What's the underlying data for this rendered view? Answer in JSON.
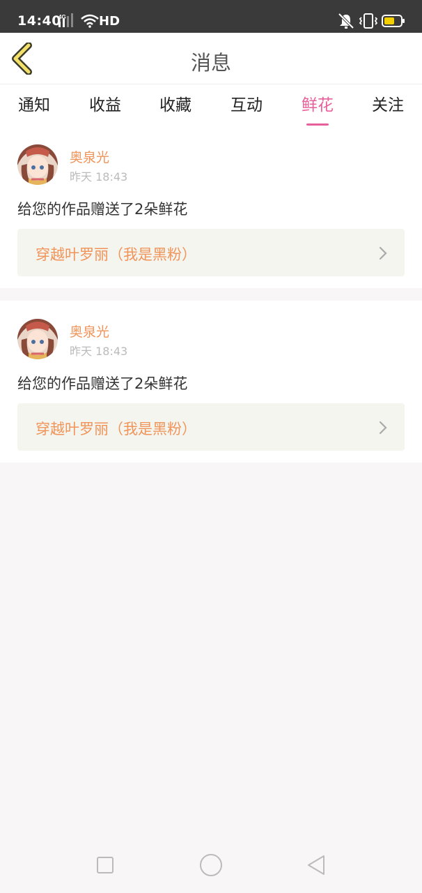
{
  "status_bar": {
    "time": "14:40",
    "network": "4G",
    "hd": "HD"
  },
  "header": {
    "title": "消息"
  },
  "tabs": [
    {
      "label": "通知",
      "active": false
    },
    {
      "label": "收益",
      "active": false
    },
    {
      "label": "收藏",
      "active": false
    },
    {
      "label": "互动",
      "active": false
    },
    {
      "label": "鲜花",
      "active": true
    },
    {
      "label": "关注",
      "active": false
    }
  ],
  "messages": [
    {
      "user": "奥泉光",
      "time": "昨天 18:43",
      "text": "给您的作品赠送了2朵鲜花",
      "work_title": "穿越叶罗丽（我是黑粉）"
    },
    {
      "user": "奥泉光",
      "time": "昨天 18:43",
      "text": "给您的作品赠送了2朵鲜花",
      "work_title": "穿越叶罗丽（我是黑粉）"
    }
  ],
  "colors": {
    "accent": "#e8609b",
    "name_orange": "#f0945a",
    "status_bar_bg": "#3a3a3a"
  }
}
